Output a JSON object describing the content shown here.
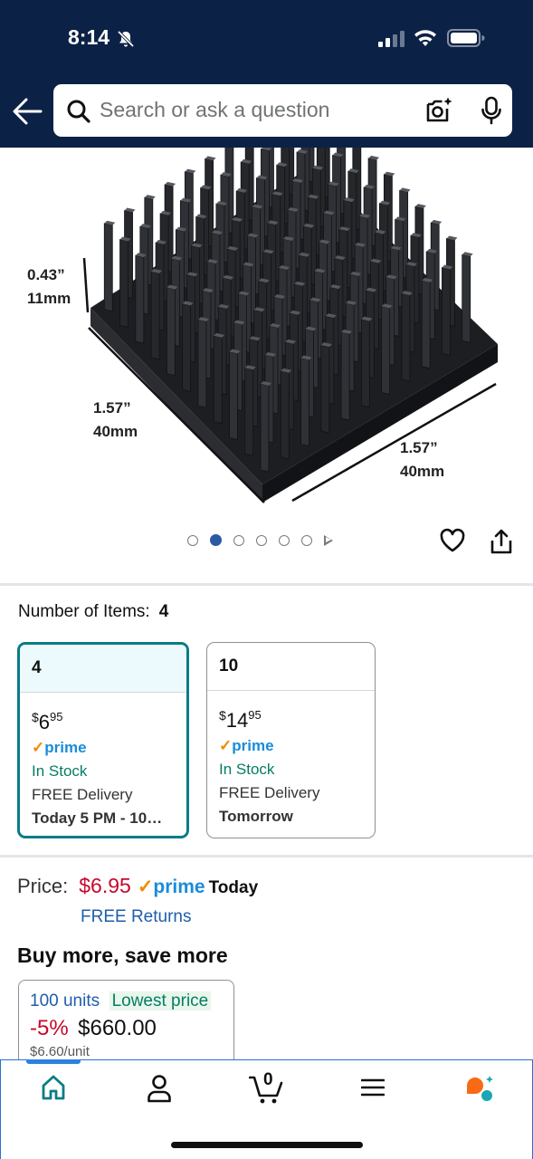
{
  "status_bar": {
    "time": "8:14"
  },
  "search": {
    "placeholder": "Search or ask a question"
  },
  "product_image": {
    "dim_height": "0.43”",
    "dim_height_mm": "11mm",
    "dim_depth": "1.57”",
    "dim_depth_mm": "40mm",
    "dim_width": "1.57”",
    "dim_width_mm": "40mm",
    "carousel_count": 6,
    "carousel_active": 2
  },
  "variation": {
    "label": "Number of Items:",
    "selected_value": "4",
    "options": [
      {
        "title": "4",
        "currency": "$",
        "whole": "6",
        "fraction": "95",
        "prime": "prime",
        "stock": "In Stock",
        "delivery": "FREE Delivery",
        "date": "Today 5 PM - 10…",
        "selected": true
      },
      {
        "title": "10",
        "currency": "$",
        "whole": "14",
        "fraction": "95",
        "prime": "prime",
        "stock": "In Stock",
        "delivery": "FREE Delivery",
        "date": "Tomorrow",
        "selected": false
      }
    ]
  },
  "price": {
    "label": "Price:",
    "value": "$6.95",
    "prime": "prime",
    "when": "Today",
    "returns": "FREE Returns"
  },
  "buy_more": {
    "title": "Buy more, save more",
    "tier": {
      "units": "100 units",
      "badge": "Lowest price",
      "discount": "-5%",
      "price": "$660.00",
      "unit_price": "$6.60/unit"
    }
  },
  "bottom_nav": {
    "cart_count": "0",
    "active": "home",
    "items": [
      "home-icon",
      "account-icon",
      "cart-icon",
      "menu-icon",
      "rufus-icon"
    ]
  },
  "colors": {
    "header_bg": "#0b2246",
    "price_red": "#c7092b",
    "prime_blue": "#1a8cd8",
    "link_blue": "#1f5eab",
    "stock_green": "#067d62",
    "selected_border": "#0a7c86"
  }
}
